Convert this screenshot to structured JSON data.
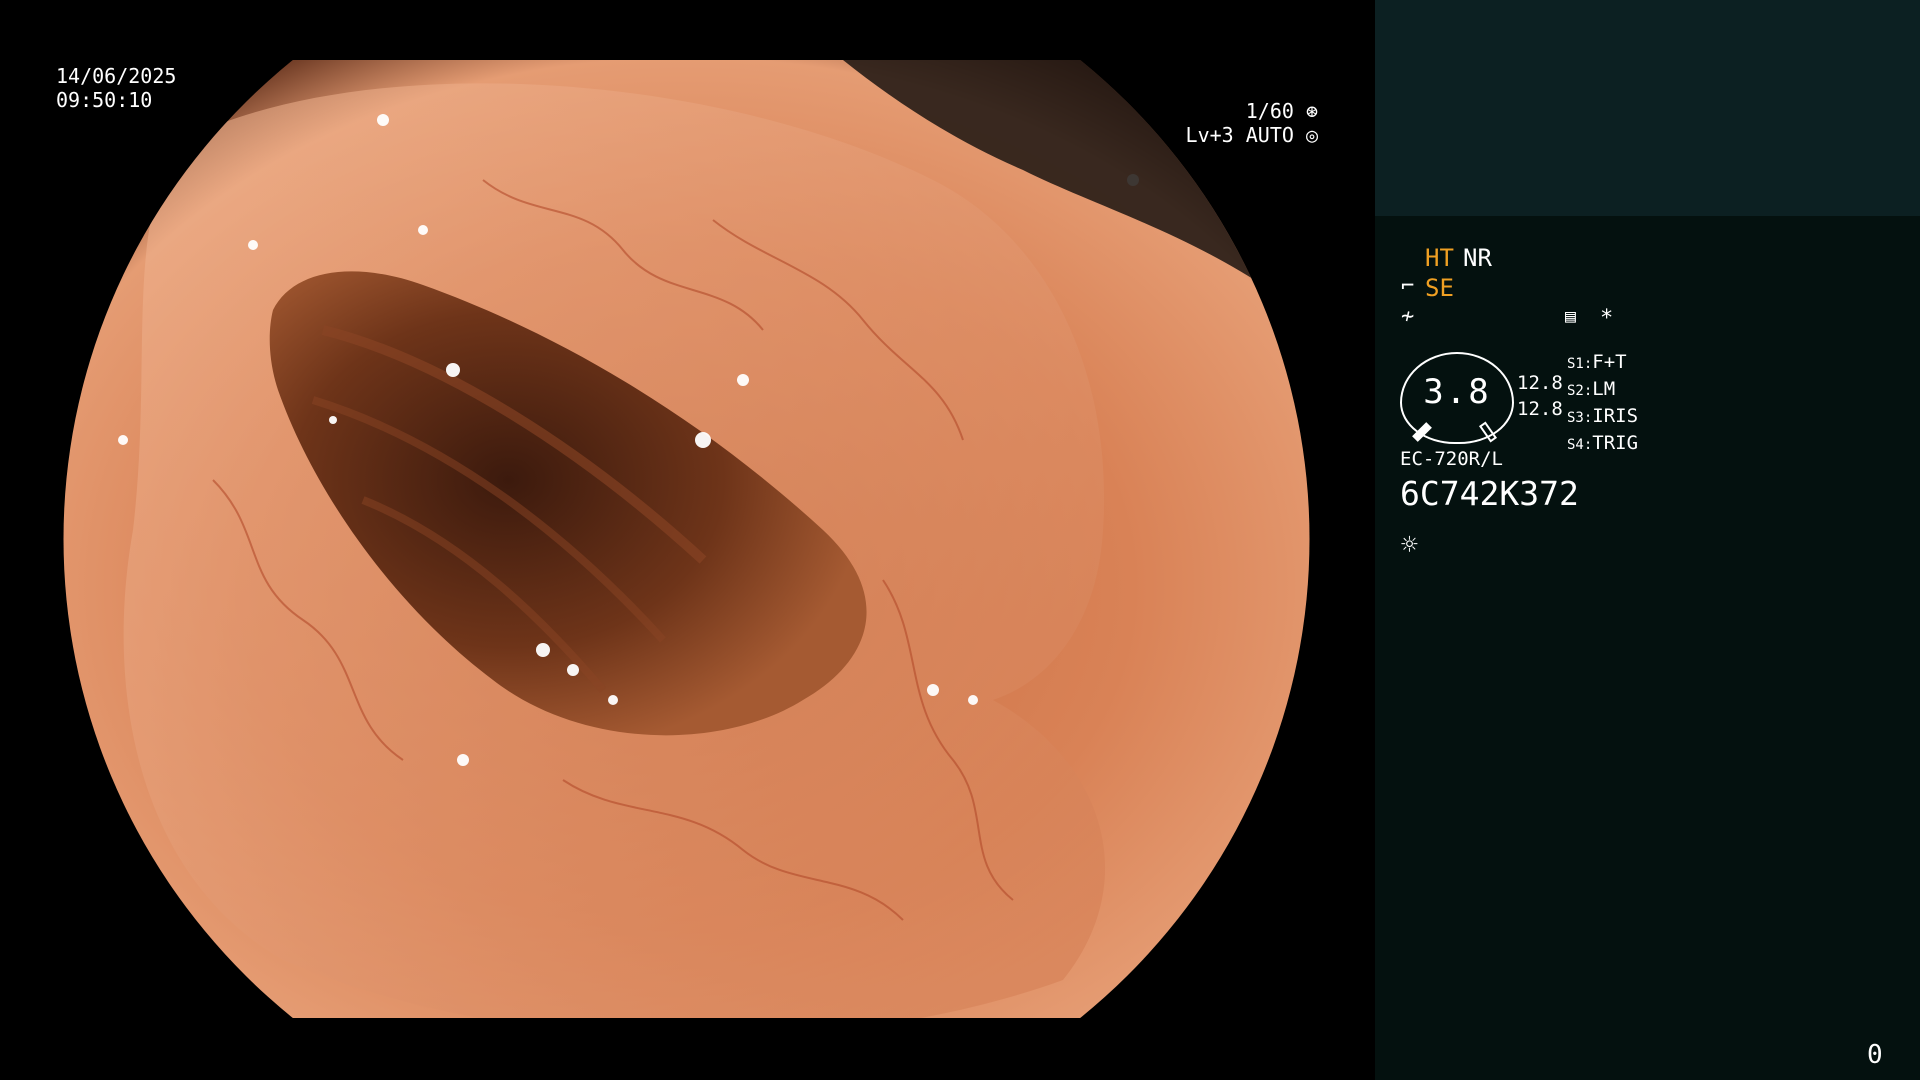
{
  "overlay": {
    "date": "14/06/2025",
    "time": "09:50:10",
    "shutter": "1/60",
    "level": "Lv+3 AUTO"
  },
  "panel": {
    "mode_ht": "HT",
    "mode_nr": "NR",
    "mode_se": "SE",
    "star": "*",
    "gauge_value": "3.8",
    "readout_1": "12.8",
    "readout_2": "12.8",
    "switches": [
      {
        "key": "S1:",
        "value": "F+T"
      },
      {
        "key": "S2:",
        "value": "LM"
      },
      {
        "key": "S3:",
        "value": "IRIS"
      },
      {
        "key": "S4:",
        "value": "TRIG"
      }
    ],
    "scope_model": "EC-720R/L",
    "serial": "6C742K372",
    "counter": "0"
  },
  "colors": {
    "panel_bg": "#04110f",
    "panel_top_bg": "#0c2022",
    "accent_orange": "#f0a023",
    "text": "#ffffff"
  },
  "icons": [
    "aperture-icon",
    "auto-exposure-icon",
    "scope-tip-icon",
    "freeze-icon",
    "menu-icon",
    "light-source-icon"
  ]
}
